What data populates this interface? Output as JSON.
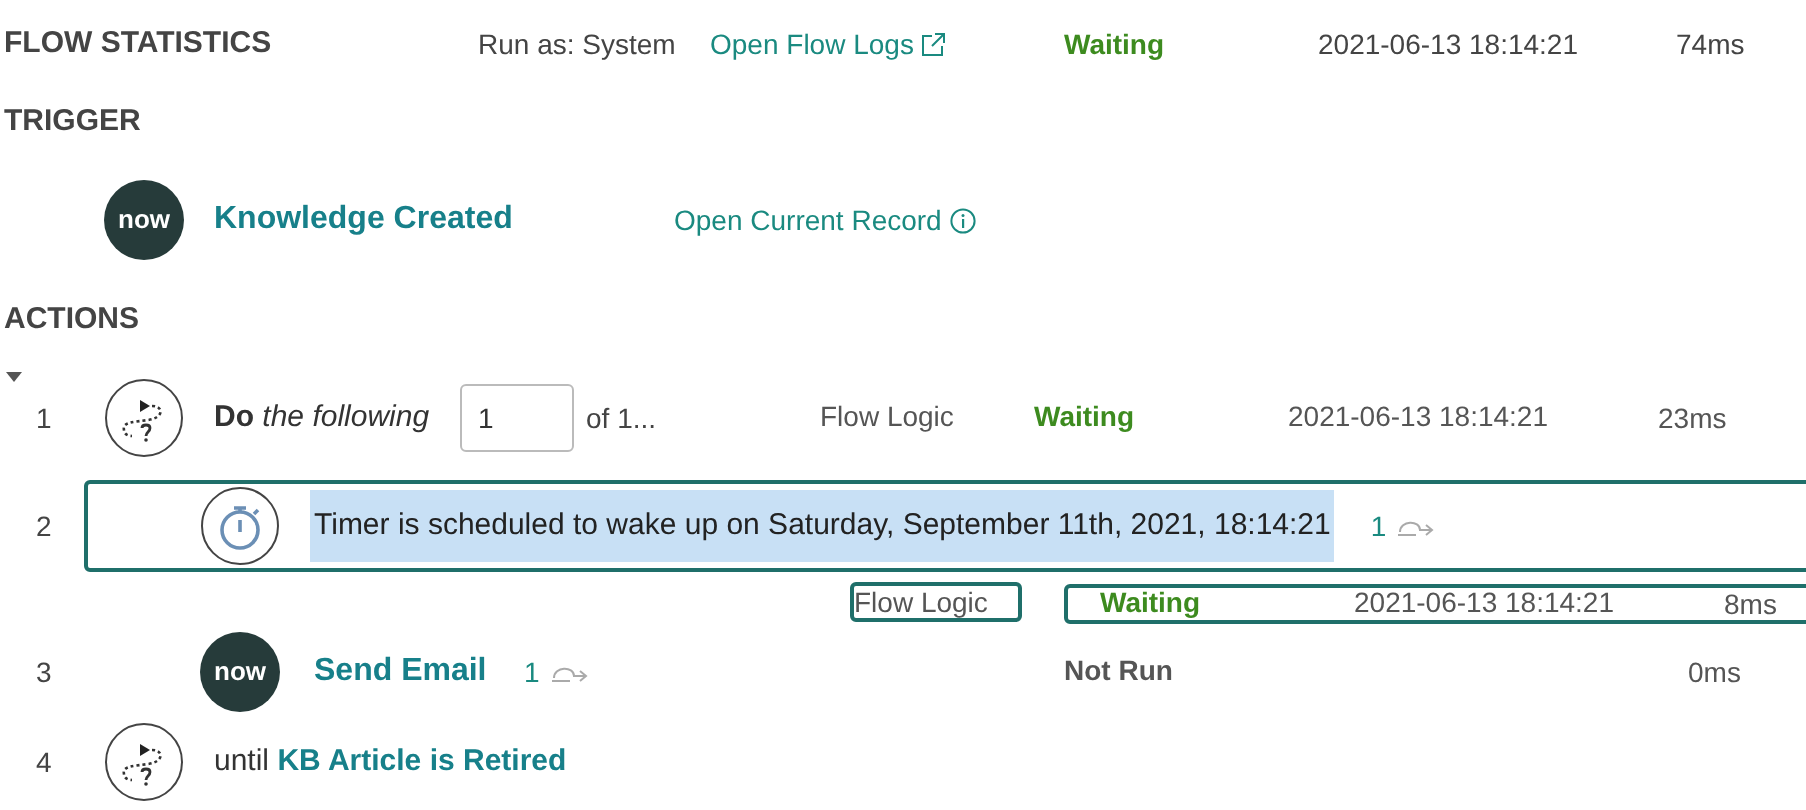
{
  "flow_statistics": {
    "title": "FLOW STATISTICS",
    "run_as": "Run as: System",
    "logs_link": "Open Flow Logs",
    "status": {
      "kind": "waiting",
      "label": "Waiting"
    },
    "timestamp": "2021-06-13 18:14:21",
    "duration": "74ms"
  },
  "trigger": {
    "heading": "TRIGGER",
    "logo": "now",
    "name": "Knowledge Created",
    "record_link": "Open Current Record"
  },
  "actions": {
    "heading": "ACTIONS",
    "expanded": true,
    "rows": [
      {
        "kind": "loop_do",
        "number": "1",
        "text": "**Do** *the following*",
        "iteration": "1",
        "of": "of 1...",
        "type": "Flow Logic",
        "status": {
          "kind": "waiting",
          "label": "Waiting"
        },
        "timestamp": "2021-06-13 18:14:21",
        "duration": "23ms"
      },
      {
        "kind": "timer",
        "number": "2",
        "selected": true,
        "text": "Timer is scheduled to wake up on Saturday, September 11th, 2021, 18:14:21",
        "count": "1",
        "details": {
          "type": "Flow Logic",
          "status": {
            "kind": "waiting",
            "label": "Waiting"
          },
          "timestamp": "2021-06-13 18:14:21",
          "duration": "8ms"
        }
      },
      {
        "kind": "action",
        "number": "3",
        "logo": "now",
        "name": "Send Email",
        "count": "1",
        "status": {
          "kind": "not_run",
          "label": "Not Run"
        },
        "duration": "0ms"
      },
      {
        "kind": "loop_until",
        "number": "4",
        "text": "until **KB Article is Retired**"
      }
    ]
  }
}
